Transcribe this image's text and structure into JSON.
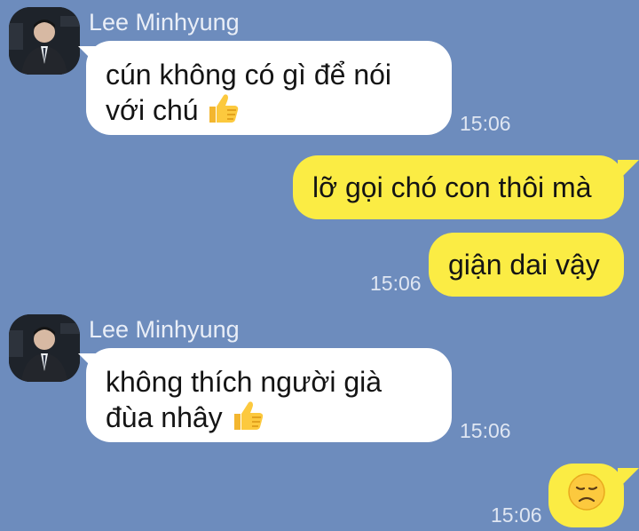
{
  "messages": [
    {
      "sender": "Lee Minhyung",
      "lines": [
        "cún không có gì để nói",
        "với chú"
      ],
      "emoji": "thumbs-up-icon",
      "time": "15:06"
    },
    {
      "text": "lỡ gọi chó con thôi mà"
    },
    {
      "text": "giận dai vậy",
      "time": "15:06"
    },
    {
      "sender": "Lee Minhyung",
      "lines": [
        "không thích người già",
        "đùa nhây"
      ],
      "emoji": "thumbs-up-icon",
      "time": "15:06"
    },
    {
      "emoji": "disappointed-face-icon",
      "time": "15:06"
    }
  ],
  "colors": {
    "background": "#6d8cbd",
    "incoming_bubble": "#ffffff",
    "outgoing_bubble": "#fbec44"
  }
}
